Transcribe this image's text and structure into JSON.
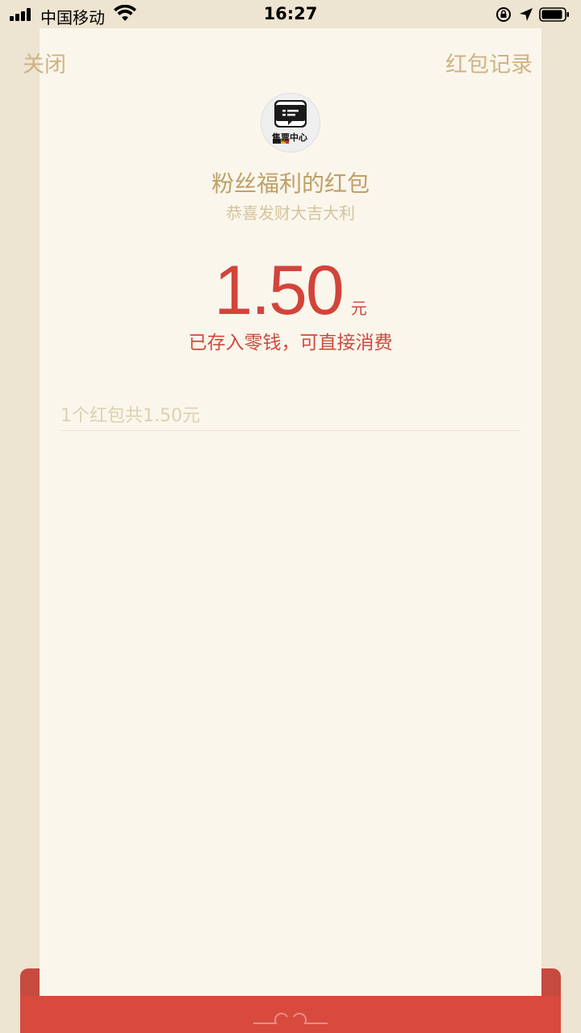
{
  "status": {
    "carrier": "中国移动",
    "time": "16:27"
  },
  "header": {
    "close_label": "关闭",
    "records_label": "红包记录"
  },
  "card": {
    "avatar_text": "售票中心",
    "title": "粉丝福利的红包",
    "subtitle": "恭喜发财大吉大利",
    "amount": "1.50",
    "unit": "元",
    "stored_message": "已存入零钱，可直接消费",
    "summary": "1个红包共1.50元"
  },
  "colors": {
    "accent_gold": "#bf9f67",
    "amount_red": "#d2443a",
    "bottom_red": "#d84a3e"
  }
}
